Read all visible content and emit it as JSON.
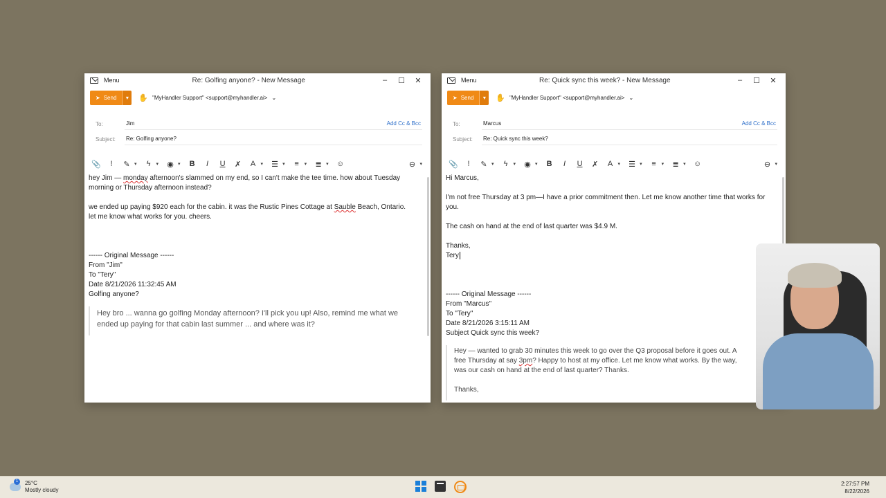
{
  "window1": {
    "menu_label": "Menu",
    "title": "Re: Golfing anyone? - New Message",
    "send_label": "Send",
    "from": "\"MyHandler Support\" <support@myhandler.ai>",
    "to_label": "To:",
    "to_value": "Jim",
    "add_cc": "Add Cc & Bcc",
    "subject_label": "Subject:",
    "subject_value": "Re: Golfing anyone?",
    "body": {
      "l1a": "hey Jim — ",
      "l1b": "monday",
      "l1c": " afternoon's slammed on my end, so I can't make the tee time. how about Tuesday",
      "l2": "morning or Thursday afternoon instead?",
      "l3a": "we ended up paying $920 each for the cabin. it was the Rustic Pines Cottage at ",
      "l3b": "Sauble",
      "l3c": " Beach, Ontario.",
      "l4": "let me know what works for you. cheers.",
      "orig_header": "------ Original Message ------",
      "orig_from": "From \"Jim\"",
      "orig_to": "To \"Tery\"",
      "orig_date": "Date 8/21/2026 11:32:45 AM",
      "orig_subject": "Golfing anyone?",
      "quote": "Hey bro ... wanna go golfing Monday afternoon?  I'll pick you up!  Also, remind me what we ended up paying for that cabin last summer ... and where was it?"
    }
  },
  "window2": {
    "menu_label": "Menu",
    "title": "Re: Quick sync this week? - New Message",
    "send_label": "Send",
    "from": "\"MyHandler Support\" <support@myhandler.ai>",
    "to_label": "To:",
    "to_value": "Marcus",
    "add_cc": "Add Cc & Bcc",
    "subject_label": "Subject:",
    "subject_value": "Re: Quick sync this week?",
    "body": {
      "greeting": "Hi Marcus,",
      "p1": "I'm not free Thursday at 3 pm—I have a prior commitment then. Let me know another time that works for you.",
      "p2": "The cash on hand at the end of last quarter was $4.9 M.",
      "thanks": "Thanks,",
      "sig": "Tery",
      "orig_header": "------ Original Message ------",
      "orig_from": "From \"Marcus\"",
      "orig_to": "To \"Tery\"",
      "orig_date": "Date 8/21/2026 3:15:11 AM",
      "orig_subject": "Subject Quick sync this week?",
      "quote_a": "Hey — wanted to grab 30 minutes this week to go over the Q3 proposal before it goes out. A",
      "quote_b1": "free Thursday at say ",
      "quote_b2": "3pm",
      "quote_b3": "? Happy to host at my office. Let me know what works.  By the way,",
      "quote_c": "was our cash on hand at the end of last quarter?  Thanks.",
      "quote_thanks": "Thanks,"
    }
  },
  "taskbar": {
    "temp": "25°C",
    "weather": "Mostly cloudy",
    "time": "2:27:57 PM",
    "date": "8/22/2026"
  },
  "colors": {
    "accent": "#f08a16",
    "link": "#2c6ec9",
    "desktop": "#7c7460"
  }
}
